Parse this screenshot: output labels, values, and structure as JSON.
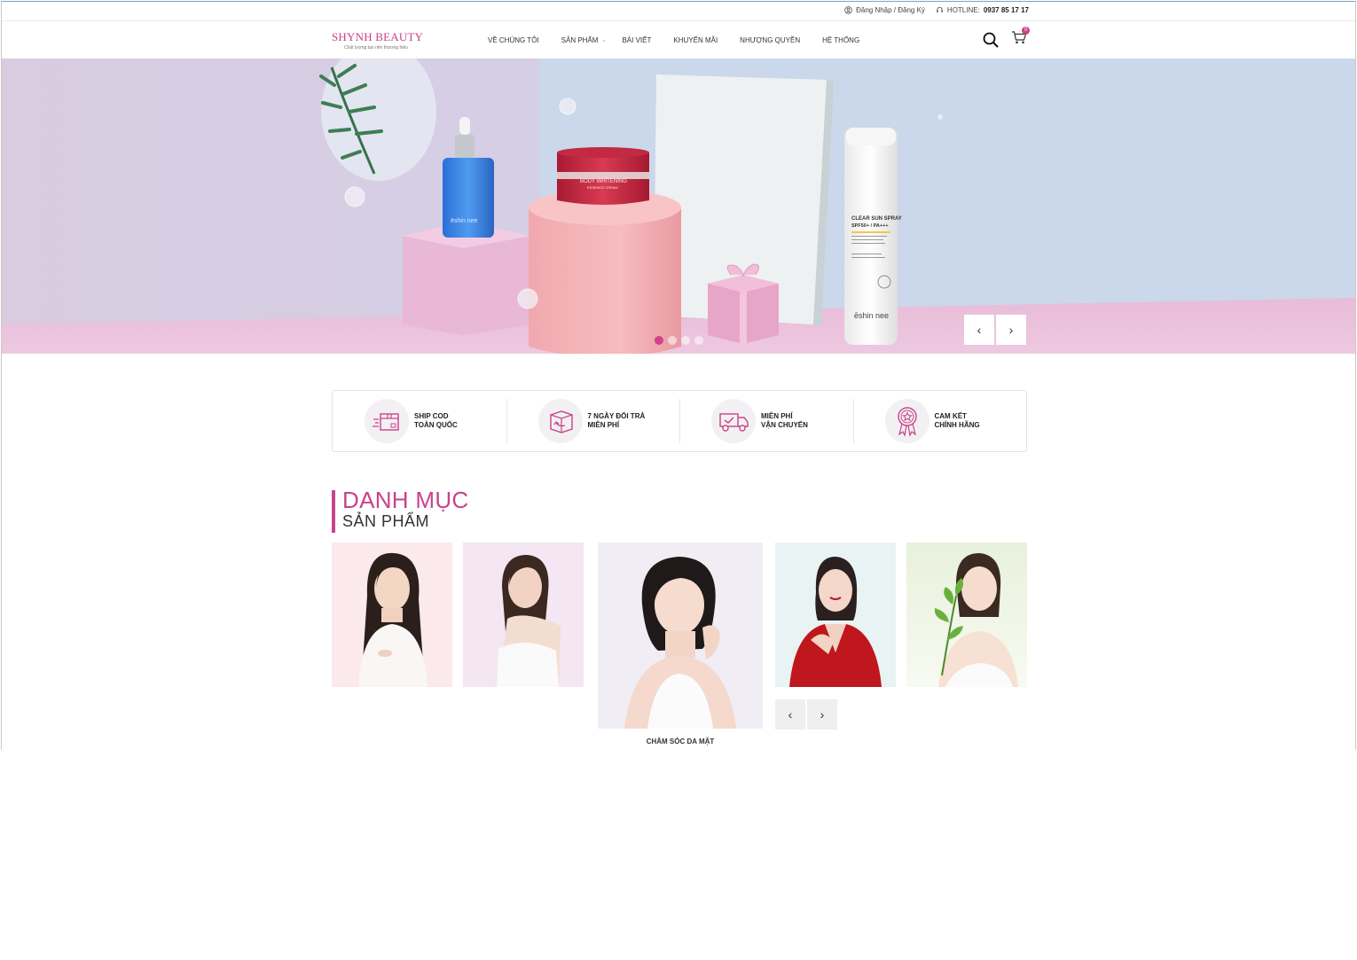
{
  "topbar": {
    "login_label": "Đăng Nhập / Đăng Ký",
    "hotline_label": "HOTLINE:",
    "hotline_number": "0937 85 17 17"
  },
  "header": {
    "brand": "SHYNH BEAUTY",
    "slogan": "Chất lượng tạo nên thương hiệu",
    "nav": [
      {
        "label": "VỀ CHÚNG TÔI"
      },
      {
        "label": "SẢN PHẨM",
        "caret": "⌄"
      },
      {
        "label": "BÀI VIẾT"
      },
      {
        "label": "KHUYẾN MÃI"
      },
      {
        "label": "NHƯỢNG QUYỀN"
      },
      {
        "label": "HỆ THỐNG"
      }
    ],
    "cart_count": "0"
  },
  "hero": {
    "prev_icon": "‹",
    "next_icon": "›",
    "slide_count": 4,
    "active_slide": 1,
    "products": {
      "serum_brand": "ēshin nee",
      "cream_label": "BODY WHITENING",
      "cream_sub": "ESSENCE CREAM",
      "spray_label": "CLEAR SUN SPRAY",
      "spray_spf": "SPF50+ / PA+++",
      "spray_brand": "ēshin nee"
    }
  },
  "services": [
    {
      "line1": "SHIP COD",
      "line2": "TOÀN QUỐC",
      "icon": "box-icon"
    },
    {
      "line1": "7 NGÀY ĐỔI TRẢ",
      "line2": "MIỄN PHÍ",
      "icon": "return-box-icon"
    },
    {
      "line1": "MIỄN PHÍ",
      "line2": "VẬN CHUYỂN",
      "icon": "truck-icon"
    },
    {
      "line1": "CAM KẾT",
      "line2": "CHÍNH HÃNG",
      "icon": "badge-icon"
    }
  ],
  "category": {
    "title_line1": "DANH MỤC",
    "title_line2": "SẢN PHẨM",
    "featured_label": "CHĂM SÓC DA MẶT",
    "prev_icon": "‹",
    "next_icon": "›"
  },
  "colors": {
    "accent": "#c8438a"
  }
}
